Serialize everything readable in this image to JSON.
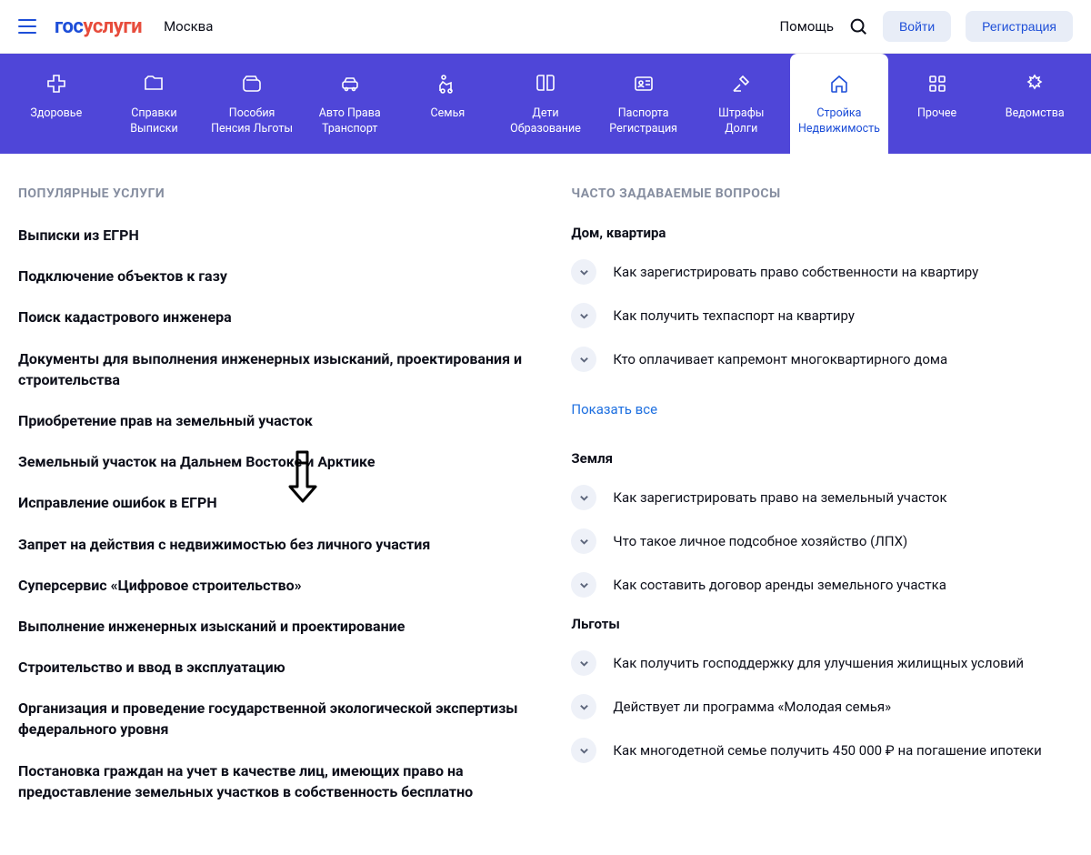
{
  "header": {
    "logo_blue": "гос",
    "logo_red": "услуги",
    "city": "Москва",
    "help": "Помощь",
    "login": "Войти",
    "register": "Регистрация"
  },
  "nav": [
    {
      "label": "Здоровье",
      "icon": "plus-medical"
    },
    {
      "label": "Справки\nВыписки",
      "icon": "folder"
    },
    {
      "label": "Пособия\nПенсия Льготы",
      "icon": "wallet"
    },
    {
      "label": "Авто Права\nТранспорт",
      "icon": "car"
    },
    {
      "label": "Семья",
      "icon": "baby"
    },
    {
      "label": "Дети\nОбразование",
      "icon": "book"
    },
    {
      "label": "Паспорта\nРегистрация",
      "icon": "id-card"
    },
    {
      "label": "Штрафы\nДолги",
      "icon": "gavel"
    },
    {
      "label": "Стройка\nНедвижимость",
      "icon": "house",
      "active": true
    },
    {
      "label": "Прочее",
      "icon": "grid"
    },
    {
      "label": "Ведомства",
      "icon": "emblem"
    }
  ],
  "popular": {
    "title": "ПОПУЛЯРНЫЕ УСЛУГИ",
    "items": [
      "Выписки из ЕГРН",
      "Подключение объектов к газу",
      "Поиск кадастрового инженера",
      "Документы для выполнения инженерных изысканий, проектирования и строительства",
      "Приобретение прав на земельный участок",
      "Земельный участок на Дальнем Востоке и Арктике",
      "Исправление ошибок в ЕГРН",
      "Запрет на действия с недвижимостью без личного участия",
      "Суперсервис «Цифровое строительство»",
      "Выполнение инженерных изысканий и проектирование",
      "Строительство и ввод в эксплуатацию",
      "Организация и проведение государственной экологической экспертизы федерального уровня",
      "Постановка граждан на учет в качестве лиц, имеющих право на предоставление земельных участков в собственность бесплатно"
    ]
  },
  "faq": {
    "title": "ЧАСТО ЗАДАВАЕМЫЕ ВОПРОСЫ",
    "show_all": "Показать все",
    "groups": [
      {
        "title": "Дом, квартира",
        "items": [
          "Как зарегистрировать право собственности на квартиру",
          "Как получить техпаспорт на квартиру",
          "Кто оплачивает капремонт многоквартирного дома"
        ]
      },
      {
        "title": "Земля",
        "items": [
          "Как зарегистрировать право на земельный участок",
          "Что такое личное подсобное хозяйство (ЛПХ)",
          "Как составить договор аренды земельного участка"
        ]
      },
      {
        "title": "Льготы",
        "items": [
          "Как получить господдержку для улучшения жилищных условий",
          "Действует ли программа «Молодая семья»",
          "Как многодетной семье получить 450 000 ₽ на погашение ипотеки"
        ]
      }
    ]
  }
}
